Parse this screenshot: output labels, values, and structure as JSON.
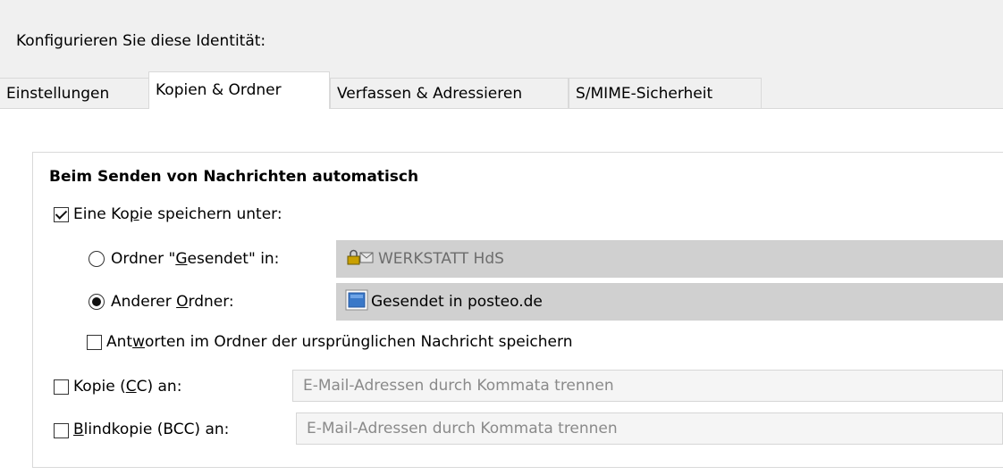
{
  "heading": "Konfigurieren Sie diese Identität:",
  "tabs": [
    {
      "label": "Einstellungen",
      "active": false
    },
    {
      "label": "Kopien & Ordner",
      "active": true
    },
    {
      "label": "Verfassen & Adressieren",
      "active": false
    },
    {
      "label": "S/MIME-Sicherheit",
      "active": false
    }
  ],
  "group": {
    "title": "Beim Senden von Nachrichten automatisch",
    "save_copy": {
      "checked": true,
      "pre": "Eine Ko",
      "key": "p",
      "post": "ie speichern unter:"
    },
    "radio_sent": {
      "selected": false,
      "pre": "Ordner \"",
      "key": "G",
      "post": "esendet\" in:",
      "folder": "WERKSTATT HdS",
      "folder_icon": "locked-mail-account-icon"
    },
    "radio_other": {
      "selected": true,
      "pre": "Anderer ",
      "key": "O",
      "post": "rdner:",
      "folder": "Gesendet in posteo.de",
      "folder_icon": "blue-folder-icon"
    },
    "replies_in_folder": {
      "checked": false,
      "pre": "Ant",
      "key": "w",
      "post": "orten im Ordner der ursprünglichen Nachricht speichern"
    },
    "cc": {
      "checked": false,
      "pre": "Kopie (",
      "key": "C",
      "post": "C) an:",
      "placeholder": "E-Mail-Adressen durch Kommata trennen"
    },
    "bcc": {
      "checked": false,
      "pre": "",
      "key": "B",
      "post": "lindkopie (BCC) an:",
      "placeholder": "E-Mail-Adressen durch Kommata trennen"
    }
  },
  "colors": {
    "window_bg": "#f0f0f0",
    "panel_bg": "#ffffff",
    "folder_box_bg": "#d0d0d0",
    "input_bg": "#f5f5f5",
    "placeholder": "#8a8a8a"
  }
}
